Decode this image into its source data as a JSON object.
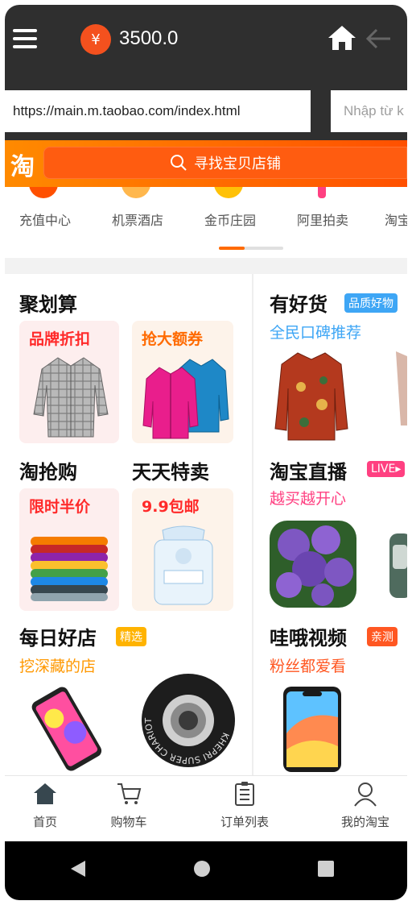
{
  "header": {
    "currency_symbol": "¥",
    "balance": "3500.0"
  },
  "url_bar": {
    "url": "https://main.m.taobao.com/index.html",
    "side_placeholder": "Nhập từ k"
  },
  "taobao": {
    "logo_char": "淘",
    "search_label": "寻找宝贝店铺"
  },
  "categories": [
    {
      "label": "充值中心",
      "color": "#ff5000"
    },
    {
      "label": "机票酒店",
      "color": "#ffb74d"
    },
    {
      "label": "金币庄园",
      "color": "#ffc107"
    },
    {
      "label": "阿里拍卖",
      "color": "#ff4081"
    },
    {
      "label": "淘宝",
      "color": "#ff9800"
    }
  ],
  "sections": {
    "juhuasuan": {
      "title": "聚划算",
      "cards": [
        "品牌折扣",
        "抢大额券"
      ]
    },
    "youhaohuo": {
      "title": "有好货",
      "tag": "品质好物",
      "subtitle": "全民口碑推荐"
    },
    "taoqianggou": {
      "title": "淘抢购",
      "card": "限时半价"
    },
    "tiantiantemai": {
      "title": "天天特卖",
      "card": "9.9包邮"
    },
    "live": {
      "title": "淘宝直播",
      "tag": "LIVE",
      "subtitle": "越买越开心"
    },
    "meirihaodian": {
      "title": "每日好店",
      "tag": "精选",
      "subtitle": "挖深藏的店"
    },
    "video": {
      "title": "哇哦视频",
      "tag": "亲测",
      "subtitle": "粉丝都爱看"
    }
  },
  "product_print": {
    "skateboard_bearing": "KHEPRI SUPER CHARIOT"
  },
  "bottom_nav": [
    {
      "label": "首页",
      "icon": "home-icon"
    },
    {
      "label": "购物车",
      "icon": "cart-icon"
    },
    {
      "label": "订单列表",
      "icon": "order-list-icon"
    },
    {
      "label": "我的淘宝",
      "icon": "user-icon"
    }
  ],
  "colors": {
    "accent": "#ff5000",
    "topbar": "#2f2f2f",
    "red_caption": "#ff2a2a",
    "orange_caption": "#ff6a00",
    "blue_subtitle": "#3ea6f5",
    "pink_subtitle": "#ff4081"
  }
}
